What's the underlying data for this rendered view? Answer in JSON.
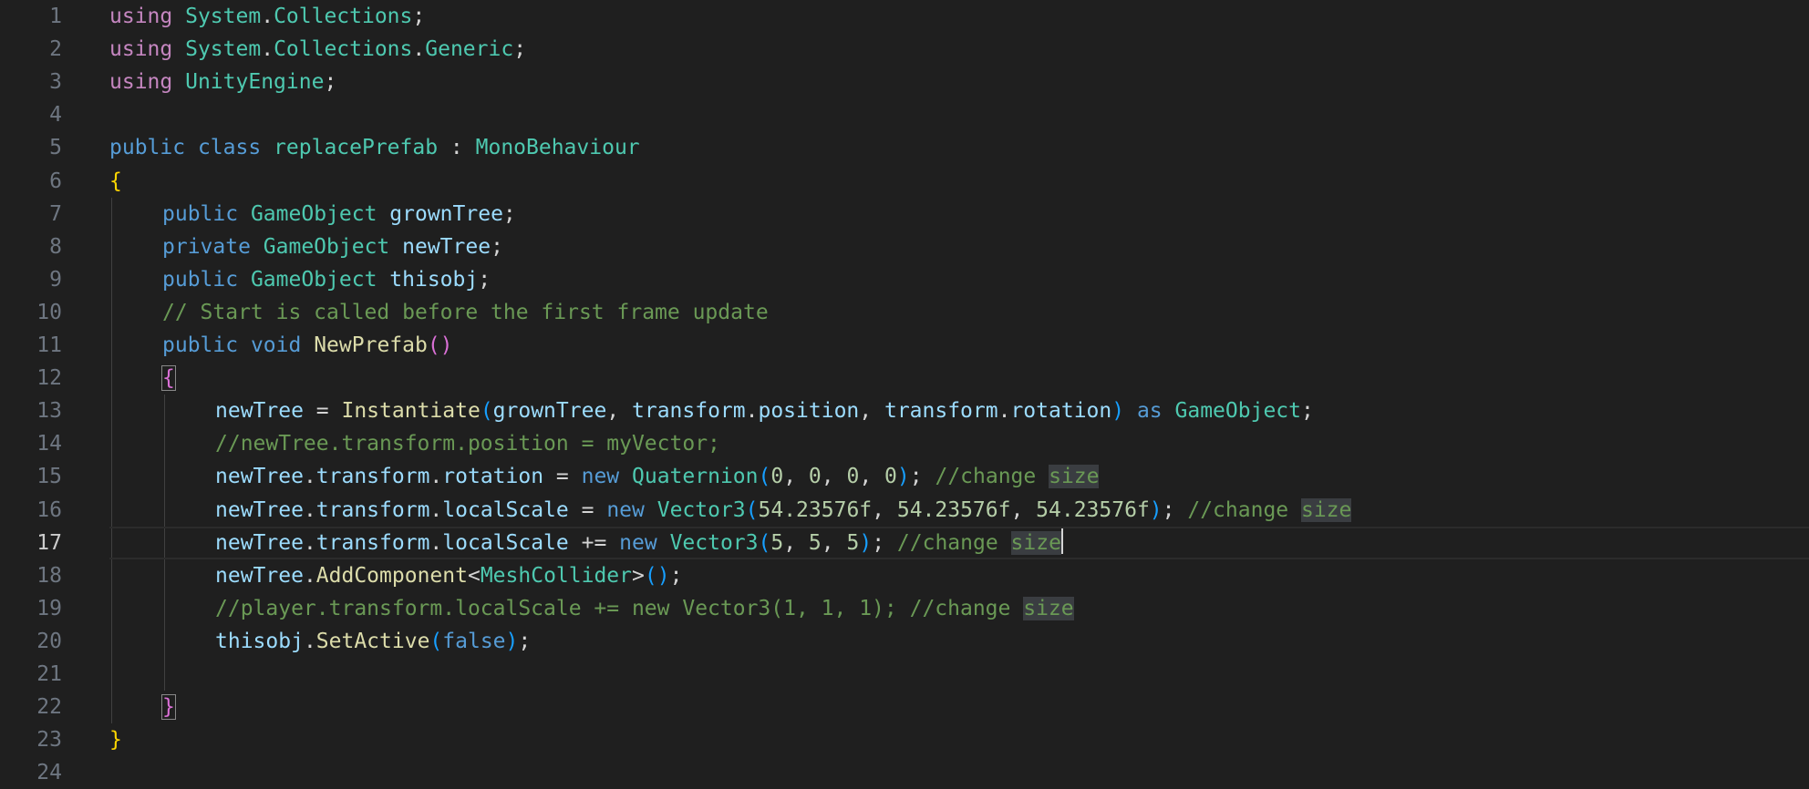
{
  "editor": {
    "cursor_line": 17,
    "colors": {
      "background": "#1f1f1f",
      "line_number": "#6e7681",
      "line_number_active": "#cccccc",
      "keyword": "#569cd6",
      "control_keyword": "#c586c0",
      "type": "#4ec9b0",
      "variable": "#9cdcfe",
      "function": "#dcdcaa",
      "comment": "#6a9955",
      "number": "#b5cea8",
      "punctuation": "#d4d4d4",
      "brace_level1": "#ffd700",
      "brace_level2": "#da70d6",
      "brace_level3": "#179fff",
      "search_highlight": "#3a3d41"
    },
    "lines": [
      {
        "number": "1",
        "indent": 0,
        "tokens": [
          {
            "text": "using",
            "kind": "control_keyword"
          },
          {
            "text": " ",
            "kind": "punctuation"
          },
          {
            "text": "System",
            "kind": "type"
          },
          {
            "text": ".",
            "kind": "punctuation"
          },
          {
            "text": "Collections",
            "kind": "type"
          },
          {
            "text": ";",
            "kind": "punctuation"
          }
        ]
      },
      {
        "number": "2",
        "indent": 0,
        "tokens": [
          {
            "text": "using",
            "kind": "control_keyword"
          },
          {
            "text": " ",
            "kind": "punctuation"
          },
          {
            "text": "System",
            "kind": "type"
          },
          {
            "text": ".",
            "kind": "punctuation"
          },
          {
            "text": "Collections",
            "kind": "type"
          },
          {
            "text": ".",
            "kind": "punctuation"
          },
          {
            "text": "Generic",
            "kind": "type"
          },
          {
            "text": ";",
            "kind": "punctuation"
          }
        ]
      },
      {
        "number": "3",
        "indent": 0,
        "tokens": [
          {
            "text": "using",
            "kind": "control_keyword"
          },
          {
            "text": " ",
            "kind": "punctuation"
          },
          {
            "text": "UnityEngine",
            "kind": "type"
          },
          {
            "text": ";",
            "kind": "punctuation"
          }
        ]
      },
      {
        "number": "4",
        "indent": 0,
        "tokens": []
      },
      {
        "number": "5",
        "indent": 0,
        "tokens": [
          {
            "text": "public",
            "kind": "keyword"
          },
          {
            "text": " ",
            "kind": "punctuation"
          },
          {
            "text": "class",
            "kind": "keyword"
          },
          {
            "text": " ",
            "kind": "punctuation"
          },
          {
            "text": "replacePrefab",
            "kind": "type"
          },
          {
            "text": " : ",
            "kind": "punctuation"
          },
          {
            "text": "MonoBehaviour",
            "kind": "type"
          }
        ]
      },
      {
        "number": "6",
        "indent": 0,
        "tokens": [
          {
            "text": "{",
            "kind": "brace_level1"
          }
        ]
      },
      {
        "number": "7",
        "indent": 1,
        "tokens": [
          {
            "text": "public",
            "kind": "keyword"
          },
          {
            "text": " ",
            "kind": "punctuation"
          },
          {
            "text": "GameObject",
            "kind": "type"
          },
          {
            "text": " ",
            "kind": "punctuation"
          },
          {
            "text": "grownTree",
            "kind": "variable"
          },
          {
            "text": ";",
            "kind": "punctuation"
          }
        ]
      },
      {
        "number": "8",
        "indent": 1,
        "tokens": [
          {
            "text": "private",
            "kind": "keyword"
          },
          {
            "text": " ",
            "kind": "punctuation"
          },
          {
            "text": "GameObject",
            "kind": "type"
          },
          {
            "text": " ",
            "kind": "punctuation"
          },
          {
            "text": "newTree",
            "kind": "variable"
          },
          {
            "text": ";",
            "kind": "punctuation"
          }
        ]
      },
      {
        "number": "9",
        "indent": 1,
        "tokens": [
          {
            "text": "public",
            "kind": "keyword"
          },
          {
            "text": " ",
            "kind": "punctuation"
          },
          {
            "text": "GameObject",
            "kind": "type"
          },
          {
            "text": " ",
            "kind": "punctuation"
          },
          {
            "text": "thisobj",
            "kind": "variable"
          },
          {
            "text": ";",
            "kind": "punctuation"
          }
        ]
      },
      {
        "number": "10",
        "indent": 1,
        "tokens": [
          {
            "text": "// Start is called before the first frame update",
            "kind": "comment"
          }
        ]
      },
      {
        "number": "11",
        "indent": 1,
        "tokens": [
          {
            "text": "public",
            "kind": "keyword"
          },
          {
            "text": " ",
            "kind": "punctuation"
          },
          {
            "text": "void",
            "kind": "keyword"
          },
          {
            "text": " ",
            "kind": "punctuation"
          },
          {
            "text": "NewPrefab",
            "kind": "function"
          },
          {
            "text": "()",
            "kind": "brace_level2"
          }
        ]
      },
      {
        "number": "12",
        "indent": 1,
        "tokens": [
          {
            "text": "{",
            "kind": "brace_level2",
            "boxed": true
          }
        ]
      },
      {
        "number": "13",
        "indent": 2,
        "tokens": [
          {
            "text": "newTree",
            "kind": "variable"
          },
          {
            "text": " = ",
            "kind": "punctuation"
          },
          {
            "text": "Instantiate",
            "kind": "function"
          },
          {
            "text": "(",
            "kind": "brace_level3"
          },
          {
            "text": "grownTree",
            "kind": "variable"
          },
          {
            "text": ", ",
            "kind": "punctuation"
          },
          {
            "text": "transform",
            "kind": "variable"
          },
          {
            "text": ".",
            "kind": "punctuation"
          },
          {
            "text": "position",
            "kind": "variable"
          },
          {
            "text": ", ",
            "kind": "punctuation"
          },
          {
            "text": "transform",
            "kind": "variable"
          },
          {
            "text": ".",
            "kind": "punctuation"
          },
          {
            "text": "rotation",
            "kind": "variable"
          },
          {
            "text": ")",
            "kind": "brace_level3"
          },
          {
            "text": " ",
            "kind": "punctuation"
          },
          {
            "text": "as",
            "kind": "keyword"
          },
          {
            "text": " ",
            "kind": "punctuation"
          },
          {
            "text": "GameObject",
            "kind": "type"
          },
          {
            "text": ";",
            "kind": "punctuation"
          }
        ]
      },
      {
        "number": "14",
        "indent": 2,
        "tokens": [
          {
            "text": "//newTree.transform.position = myVector;",
            "kind": "comment"
          }
        ]
      },
      {
        "number": "15",
        "indent": 2,
        "tokens": [
          {
            "text": "newTree",
            "kind": "variable"
          },
          {
            "text": ".",
            "kind": "punctuation"
          },
          {
            "text": "transform",
            "kind": "variable"
          },
          {
            "text": ".",
            "kind": "punctuation"
          },
          {
            "text": "rotation",
            "kind": "variable"
          },
          {
            "text": " = ",
            "kind": "punctuation"
          },
          {
            "text": "new",
            "kind": "keyword"
          },
          {
            "text": " ",
            "kind": "punctuation"
          },
          {
            "text": "Quaternion",
            "kind": "type"
          },
          {
            "text": "(",
            "kind": "brace_level3"
          },
          {
            "text": "0",
            "kind": "number"
          },
          {
            "text": ", ",
            "kind": "punctuation"
          },
          {
            "text": "0",
            "kind": "number"
          },
          {
            "text": ", ",
            "kind": "punctuation"
          },
          {
            "text": "0",
            "kind": "number"
          },
          {
            "text": ", ",
            "kind": "punctuation"
          },
          {
            "text": "0",
            "kind": "number"
          },
          {
            "text": ")",
            "kind": "brace_level3"
          },
          {
            "text": "; ",
            "kind": "punctuation"
          },
          {
            "text": "//change ",
            "kind": "comment"
          },
          {
            "text": "size",
            "kind": "comment",
            "highlight": true
          }
        ]
      },
      {
        "number": "16",
        "indent": 2,
        "tokens": [
          {
            "text": "newTree",
            "kind": "variable"
          },
          {
            "text": ".",
            "kind": "punctuation"
          },
          {
            "text": "transform",
            "kind": "variable"
          },
          {
            "text": ".",
            "kind": "punctuation"
          },
          {
            "text": "localScale",
            "kind": "variable"
          },
          {
            "text": " = ",
            "kind": "punctuation"
          },
          {
            "text": "new",
            "kind": "keyword"
          },
          {
            "text": " ",
            "kind": "punctuation"
          },
          {
            "text": "Vector3",
            "kind": "type"
          },
          {
            "text": "(",
            "kind": "brace_level3"
          },
          {
            "text": "54.23576f",
            "kind": "number"
          },
          {
            "text": ", ",
            "kind": "punctuation"
          },
          {
            "text": "54.23576f",
            "kind": "number"
          },
          {
            "text": ", ",
            "kind": "punctuation"
          },
          {
            "text": "54.23576f",
            "kind": "number"
          },
          {
            "text": ")",
            "kind": "brace_level3"
          },
          {
            "text": "; ",
            "kind": "punctuation"
          },
          {
            "text": "//change ",
            "kind": "comment"
          },
          {
            "text": "size",
            "kind": "comment",
            "highlight": true
          }
        ]
      },
      {
        "number": "17",
        "indent": 2,
        "tokens": [
          {
            "text": "newTree",
            "kind": "variable"
          },
          {
            "text": ".",
            "kind": "punctuation"
          },
          {
            "text": "transform",
            "kind": "variable"
          },
          {
            "text": ".",
            "kind": "punctuation"
          },
          {
            "text": "localScale",
            "kind": "variable"
          },
          {
            "text": " += ",
            "kind": "punctuation"
          },
          {
            "text": "new",
            "kind": "keyword"
          },
          {
            "text": " ",
            "kind": "punctuation"
          },
          {
            "text": "Vector3",
            "kind": "type"
          },
          {
            "text": "(",
            "kind": "brace_level3"
          },
          {
            "text": "5",
            "kind": "number"
          },
          {
            "text": ", ",
            "kind": "punctuation"
          },
          {
            "text": "5",
            "kind": "number"
          },
          {
            "text": ", ",
            "kind": "punctuation"
          },
          {
            "text": "5",
            "kind": "number"
          },
          {
            "text": ")",
            "kind": "brace_level3"
          },
          {
            "text": "; ",
            "kind": "punctuation"
          },
          {
            "text": "//change ",
            "kind": "comment"
          },
          {
            "text": "size",
            "kind": "comment",
            "highlight": true,
            "cursor_after": true
          }
        ]
      },
      {
        "number": "18",
        "indent": 2,
        "tokens": [
          {
            "text": "newTree",
            "kind": "variable"
          },
          {
            "text": ".",
            "kind": "punctuation"
          },
          {
            "text": "AddComponent",
            "kind": "function"
          },
          {
            "text": "<",
            "kind": "punctuation"
          },
          {
            "text": "MeshCollider",
            "kind": "type"
          },
          {
            "text": ">",
            "kind": "punctuation"
          },
          {
            "text": "()",
            "kind": "brace_level3"
          },
          {
            "text": ";",
            "kind": "punctuation"
          }
        ]
      },
      {
        "number": "19",
        "indent": 2,
        "tokens": [
          {
            "text": "//player.transform.localScale += new Vector3(1, 1, 1); //change ",
            "kind": "comment"
          },
          {
            "text": "size",
            "kind": "comment",
            "highlight": true
          }
        ]
      },
      {
        "number": "20",
        "indent": 2,
        "tokens": [
          {
            "text": "thisobj",
            "kind": "variable"
          },
          {
            "text": ".",
            "kind": "punctuation"
          },
          {
            "text": "SetActive",
            "kind": "function"
          },
          {
            "text": "(",
            "kind": "brace_level3"
          },
          {
            "text": "false",
            "kind": "keyword"
          },
          {
            "text": ")",
            "kind": "brace_level3"
          },
          {
            "text": ";",
            "kind": "punctuation"
          }
        ]
      },
      {
        "number": "21",
        "indent": 2,
        "tokens": []
      },
      {
        "number": "22",
        "indent": 1,
        "tokens": [
          {
            "text": "}",
            "kind": "brace_level2",
            "boxed": true
          }
        ]
      },
      {
        "number": "23",
        "indent": 0,
        "tokens": [
          {
            "text": "}",
            "kind": "brace_level1"
          }
        ]
      },
      {
        "number": "24",
        "indent": 0,
        "tokens": []
      }
    ]
  }
}
